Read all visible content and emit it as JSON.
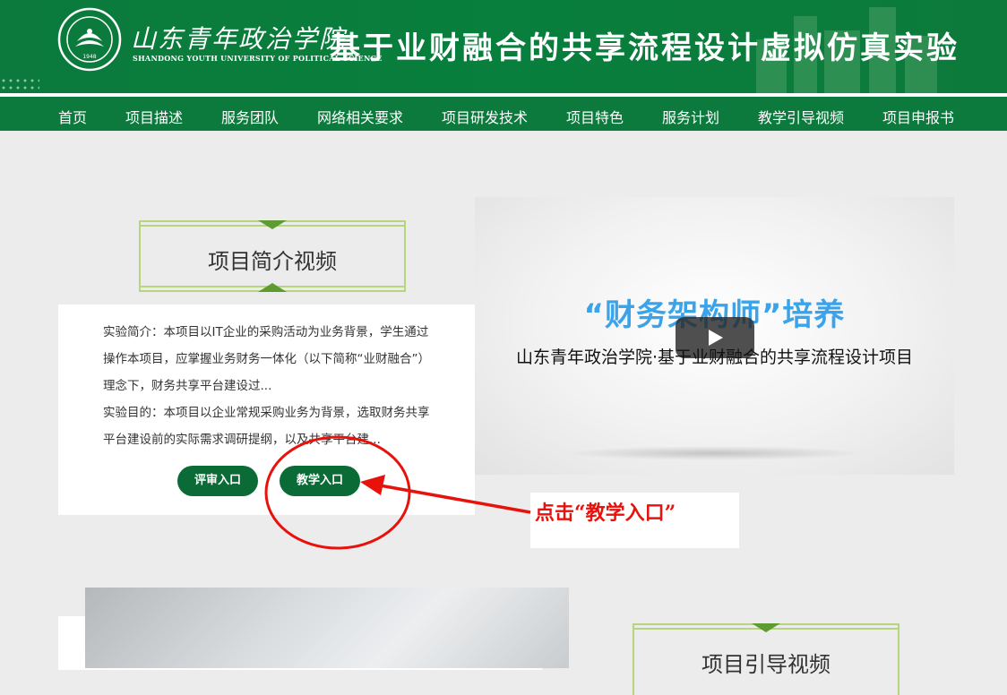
{
  "header": {
    "school_name_cn": "山东青年政治学院",
    "school_name_en": "SHANDONG YOUTH UNIVERSITY OF POLITICAL SCIENCE",
    "logo_year": "1948",
    "site_title": "基于业财融合的共享流程设计虚拟仿真实验"
  },
  "nav": {
    "items": [
      "首页",
      "项目描述",
      "服务团队",
      "网络相关要求",
      "项目研发技术",
      "项目特色",
      "服务计划",
      "教学引导视频",
      "项目申报书"
    ]
  },
  "intro": {
    "section_title": "项目简介视频",
    "paragraph_1": "实验简介：本项目以IT企业的采购活动为业务背景，学生通过操作本项目，应掌握业务财务一体化（以下简称“业财融合”）理念下，财务共享平台建设过...",
    "paragraph_2": "实验目的：本项目以企业常规采购业务为背景，选取财务共享平台建设前的实际需求调研提纲，以及共享平台建...",
    "review_button": "评审入口",
    "teaching_button": "教学入口"
  },
  "video": {
    "title": "“财务架构师”培养",
    "subtitle": "山东青年政治学院·基于业财融合的共享流程设计项目"
  },
  "annotation": {
    "text": "点击“教学入口”",
    "color": "#e8120c"
  },
  "guide": {
    "section_title": "项目引导视频"
  },
  "colors": {
    "brand_green": "#0b7a3c",
    "button_green": "#0b6b36",
    "frame_green": "#b6d57e"
  }
}
